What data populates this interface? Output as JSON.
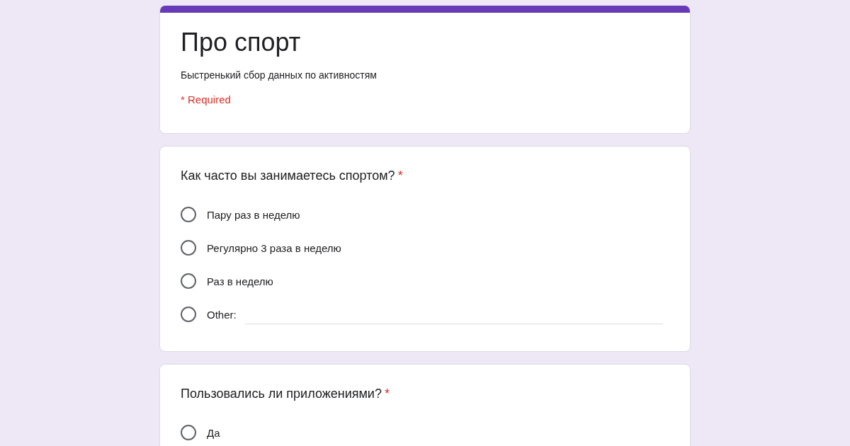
{
  "form": {
    "title": "Про спорт",
    "description": "Быстренький сбор данных по активностям",
    "required_note": "* Required"
  },
  "questions": [
    {
      "title": "Как часто вы занимаетесь спортом?",
      "required_mark": "*",
      "options": [
        {
          "kind": "option",
          "label": "Пару раз в неделю",
          "selected": false
        },
        {
          "kind": "option",
          "label": "Регулярно 3 раза в неделю",
          "selected": false
        },
        {
          "kind": "option",
          "label": "Раз в неделю",
          "selected": false
        },
        {
          "kind": "other",
          "label": "Other:",
          "selected": false
        }
      ]
    },
    {
      "title": "Пользовались ли приложениями?",
      "required_mark": "*",
      "options": [
        {
          "kind": "option",
          "label": "Да",
          "selected": false
        }
      ]
    }
  ]
}
